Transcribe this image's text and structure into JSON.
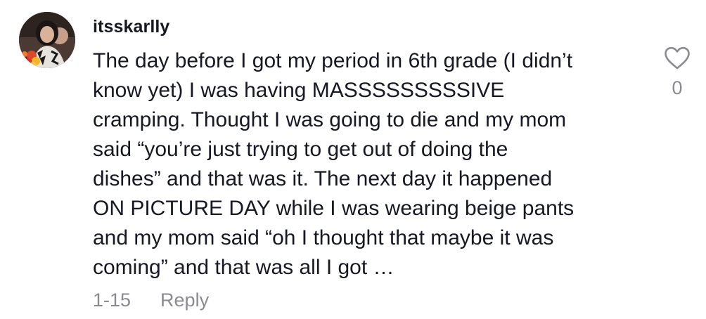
{
  "comment": {
    "username": "itsskarlly",
    "lines": [
      "The day before I got my period in 6th grade (I didn’t",
      "know yet) I was having MASSSSSSSSSIVE",
      "cramping. Thought I was going to die and my mom",
      "said “you’re just trying to get out of doing the",
      "dishes” and that was it. The next day it happened",
      "ON PICTURE DAY while I was wearing beige pants",
      "and my mom said “oh I thought that maybe it was",
      "coming” and that was all I got …"
    ],
    "timestamp": "1-15",
    "reply_label": "Reply",
    "like_count": "0",
    "like_icon": "heart-outline-icon",
    "colors": {
      "text": "#161823",
      "muted": "#8a8b91"
    }
  }
}
